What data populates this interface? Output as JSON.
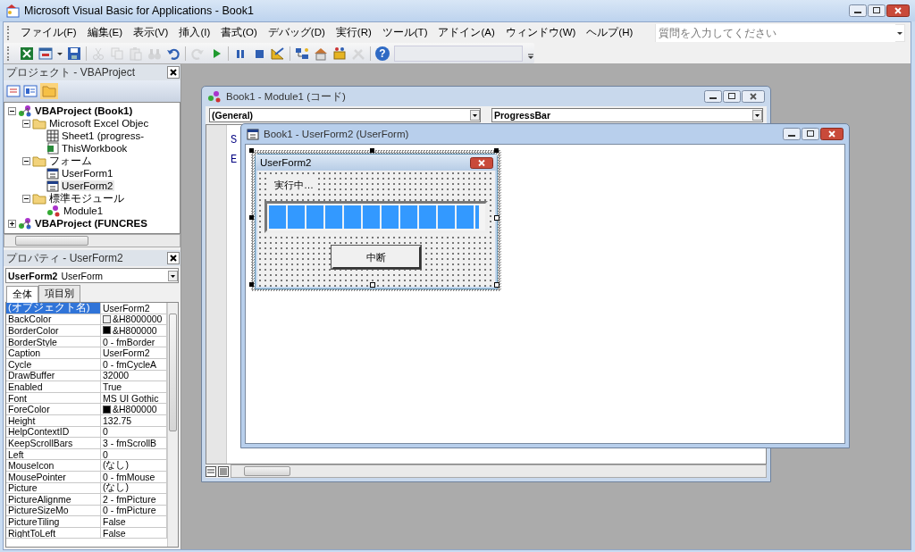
{
  "window": {
    "title": "Microsoft Visual Basic for Applications - Book1"
  },
  "menu": [
    "ファイル(F)",
    "編集(E)",
    "表示(V)",
    "挿入(I)",
    "書式(O)",
    "デバッグ(D)",
    "実行(R)",
    "ツール(T)",
    "アドイン(A)",
    "ウィンドウ(W)",
    "ヘルプ(H)"
  ],
  "ask_field": {
    "placeholder": "質問を入力してください"
  },
  "toolbar": [
    {
      "disabled": false
    },
    {
      "disabled": false
    },
    {
      "disabled": false
    },
    {
      "disabled": true
    },
    {
      "disabled": true
    },
    {
      "disabled": true
    },
    {
      "disabled": true
    },
    {
      "disabled": false
    },
    {
      "disabled": true
    },
    {
      "disabled": false
    },
    {
      "disabled": false
    },
    {
      "disabled": false
    },
    {
      "disabled": false
    },
    {
      "disabled": false
    },
    {
      "disabled": false
    },
    {
      "disabled": false
    },
    {
      "disabled": true
    },
    {
      "disabled": false,
      "text": "?"
    }
  ],
  "project": {
    "title": "プロジェクト - VBAProject",
    "tree": [
      {
        "label": "VBAProject (Book1)",
        "kind": "project",
        "expanded": true,
        "selected": false,
        "children": [
          {
            "label": "Microsoft Excel Objec",
            "kind": "folder",
            "expanded": true,
            "selected": false,
            "children": [
              {
                "label": "Sheet1 (progress-",
                "kind": "sheet",
                "selected": false
              },
              {
                "label": "ThisWorkbook",
                "kind": "workbook",
                "selected": false
              }
            ]
          },
          {
            "label": "フォーム",
            "kind": "folder",
            "expanded": true,
            "selected": false,
            "children": [
              {
                "label": "UserForm1",
                "kind": "form",
                "selected": false
              },
              {
                "label": "UserForm2",
                "kind": "form",
                "selected": true
              }
            ]
          },
          {
            "label": "標準モジュール",
            "kind": "folder",
            "expanded": true,
            "selected": false,
            "children": [
              {
                "label": "Module1",
                "kind": "module",
                "selected": false
              }
            ]
          }
        ]
      },
      {
        "label": "VBAProject (FUNCRES",
        "kind": "project",
        "expanded": false,
        "selected": false
      }
    ]
  },
  "properties": {
    "title": "プロパティ - UserForm2",
    "object_name": "UserForm2",
    "object_type": "UserForm",
    "tabs": [
      {
        "label": "全体",
        "selected": true
      },
      {
        "label": "項目別",
        "selected": false
      }
    ],
    "rows": [
      {
        "name": "(オブジェクト名)",
        "value": "UserForm2",
        "selected": true
      },
      {
        "name": "BackColor",
        "value": "&H8000000",
        "color": "#f0f0f0",
        "selected": false
      },
      {
        "name": "BorderColor",
        "value": "&H800000",
        "color": "#000000",
        "selected": false
      },
      {
        "name": "BorderStyle",
        "value": "0 - fmBorder",
        "selected": false
      },
      {
        "name": "Caption",
        "value": "UserForm2",
        "selected": false
      },
      {
        "name": "Cycle",
        "value": "0 - fmCycleA",
        "selected": false
      },
      {
        "name": "DrawBuffer",
        "value": "32000",
        "selected": false
      },
      {
        "name": "Enabled",
        "value": "True",
        "selected": false
      },
      {
        "name": "Font",
        "value": "MS UI Gothic",
        "selected": false
      },
      {
        "name": "ForeColor",
        "value": "&H800000",
        "color": "#000000",
        "selected": false
      },
      {
        "name": "Height",
        "value": "132.75",
        "selected": false
      },
      {
        "name": "HelpContextID",
        "value": "0",
        "selected": false
      },
      {
        "name": "KeepScrollBars",
        "value": "3 - fmScrollB",
        "selected": false
      },
      {
        "name": "Left",
        "value": "0",
        "selected": false
      },
      {
        "name": "MouseIcon",
        "value": "(なし)",
        "selected": false
      },
      {
        "name": "MousePointer",
        "value": "0 - fmMouse",
        "selected": false
      },
      {
        "name": "Picture",
        "value": "(なし)",
        "selected": false
      },
      {
        "name": "PictureAlignme",
        "value": "2 - fmPicture",
        "selected": false
      },
      {
        "name": "PictureSizeMo",
        "value": "0 - fmPicture",
        "selected": false
      },
      {
        "name": "PictureTiling",
        "value": "False",
        "selected": false
      },
      {
        "name": "RightToLeft",
        "value": "False",
        "selected": false
      }
    ]
  },
  "code_window": {
    "title": "Book1 - Module1 (コード)",
    "object_combo": "(General)",
    "procedure_combo": "ProgressBar",
    "lines": [
      "S",
      "E"
    ]
  },
  "designer_window": {
    "title": "Book1 - UserForm2 (UserForm)",
    "form": {
      "caption": "UserForm2",
      "label": "実行中…",
      "progress": {
        "level": 0.98
      },
      "button": "中断"
    }
  }
}
